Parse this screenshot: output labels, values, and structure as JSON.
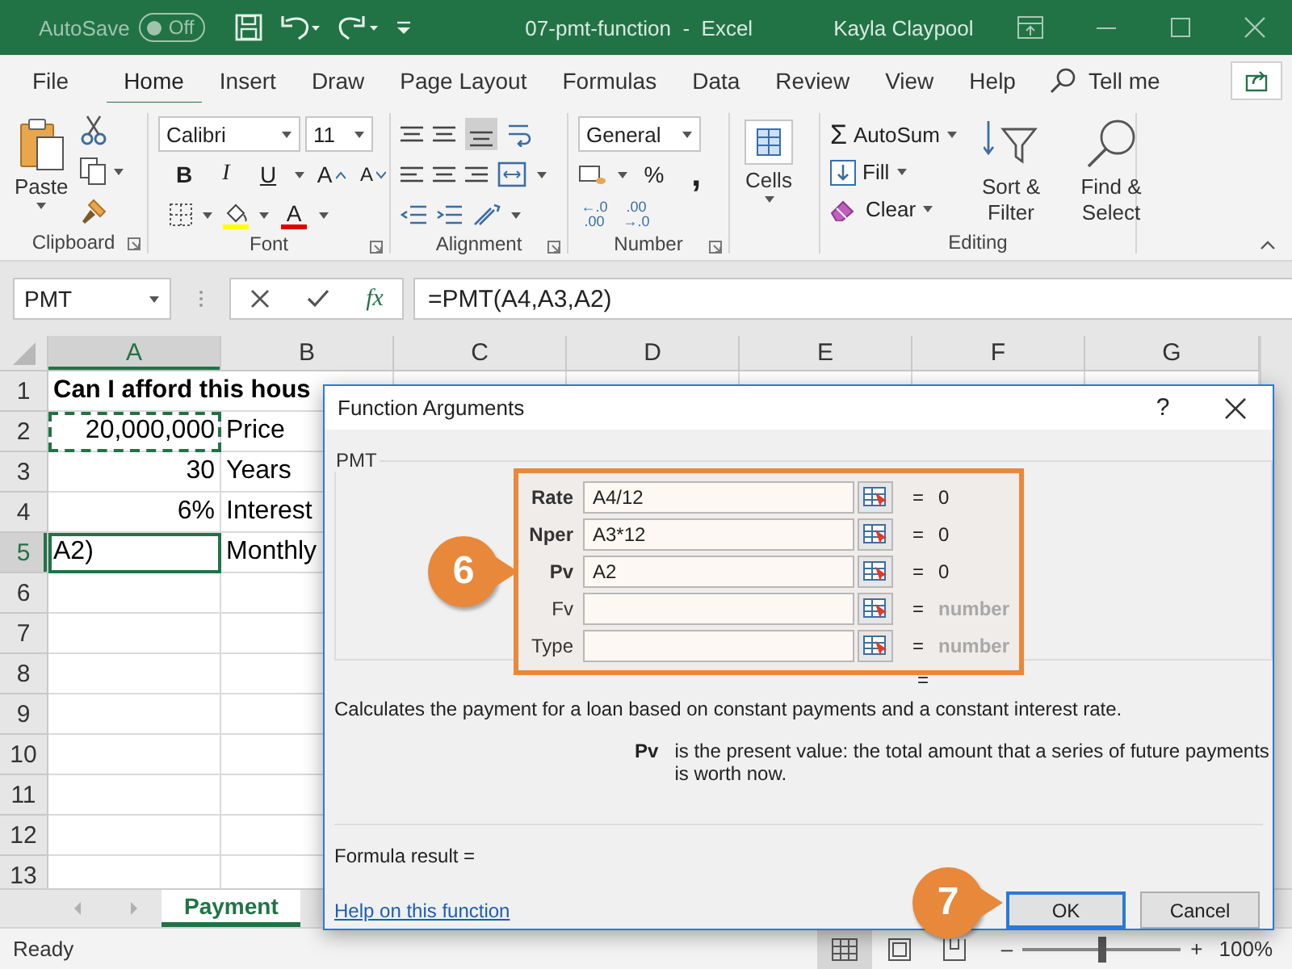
{
  "title_bar": {
    "autosave_label": "AutoSave",
    "autosave": {
      "on": false,
      "label": "Off"
    },
    "title": "07-pmt-function  -  Excel",
    "user": "Kayla Claypool"
  },
  "ribbon_tabs": [
    {
      "label": "File",
      "selected": false
    },
    {
      "label": "Home",
      "selected": true
    },
    {
      "label": "Insert",
      "selected": false
    },
    {
      "label": "Draw",
      "selected": false
    },
    {
      "label": "Page Layout",
      "selected": false
    },
    {
      "label": "Formulas",
      "selected": false
    },
    {
      "label": "Data",
      "selected": false
    },
    {
      "label": "Review",
      "selected": false
    },
    {
      "label": "View",
      "selected": false
    },
    {
      "label": "Help",
      "selected": false
    }
  ],
  "tell_me": "Tell me",
  "ribbon": {
    "clipboard": {
      "label": "Clipboard",
      "paste": "Paste"
    },
    "font": {
      "label": "Font",
      "font_name": "Calibri",
      "font_size": "11",
      "bold": "B",
      "italic": "I",
      "underline": "U",
      "grow": "A",
      "shrink": "A",
      "font_color": "A"
    },
    "alignment": {
      "label": "Alignment"
    },
    "number": {
      "label": "Number",
      "format": "General",
      "percent": "%",
      "comma": ",",
      "increase_decimal": [
        "←.0",
        ".00"
      ],
      "decrease_decimal": [
        ".00",
        "→.0"
      ]
    },
    "cells": {
      "label": "Cells"
    },
    "editing": {
      "label": "Editing",
      "autosum_sign": "Σ",
      "autosum": "AutoSum",
      "fill": "Fill",
      "clear": "Clear",
      "sort": "Sort & Filter",
      "find": "Find & Select"
    }
  },
  "formula_bar": {
    "name_box": "PMT",
    "fx": "fx",
    "formula": "=PMT(A4,A3,A2)"
  },
  "sheet": {
    "columns": [
      {
        "label": "A",
        "selected": true
      },
      {
        "label": "B",
        "selected": false
      },
      {
        "label": "C",
        "selected": false
      },
      {
        "label": "D",
        "selected": false
      },
      {
        "label": "E",
        "selected": false
      },
      {
        "label": "F",
        "selected": false
      },
      {
        "label": "G",
        "selected": false
      }
    ],
    "rows": [
      {
        "label": "1",
        "selected": false,
        "cells": {
          "A": {
            "text": "Can I afford this hous",
            "kind": "title",
            "selected": false,
            "marquee": false
          }
        }
      },
      {
        "label": "2",
        "selected": false,
        "cells": {
          "A": {
            "text": "20,000,000",
            "kind": "number",
            "selected": false,
            "marquee": true
          },
          "B": {
            "text": "Price",
            "kind": "text",
            "selected": false,
            "marquee": false
          }
        }
      },
      {
        "label": "3",
        "selected": false,
        "cells": {
          "A": {
            "text": "30",
            "kind": "number",
            "selected": false,
            "marquee": false
          },
          "B": {
            "text": "Years",
            "kind": "text",
            "selected": false,
            "marquee": false
          }
        }
      },
      {
        "label": "4",
        "selected": false,
        "cells": {
          "A": {
            "text": "6%",
            "kind": "number",
            "selected": false,
            "marquee": false
          },
          "B": {
            "text": "Interest",
            "kind": "text",
            "selected": false,
            "marquee": false
          }
        }
      },
      {
        "label": "5",
        "selected": true,
        "cells": {
          "A": {
            "text": "A2)",
            "kind": "text",
            "selected": true,
            "marquee": false
          },
          "B": {
            "text": "Monthly",
            "kind": "text",
            "selected": false,
            "marquee": false
          }
        }
      },
      {
        "label": "6",
        "selected": false
      },
      {
        "label": "7",
        "selected": false
      },
      {
        "label": "8",
        "selected": false
      },
      {
        "label": "9",
        "selected": false
      },
      {
        "label": "10",
        "selected": false
      },
      {
        "label": "11",
        "selected": false
      },
      {
        "label": "12",
        "selected": false
      },
      {
        "label": "13",
        "selected": false
      }
    ]
  },
  "sheet_tabs": [
    {
      "label": "Payment",
      "selected": true
    }
  ],
  "status_bar": {
    "status": "Ready",
    "views": [
      {
        "kind": "normal",
        "selected": true
      },
      {
        "kind": "page_layout",
        "selected": false
      },
      {
        "kind": "page_break",
        "selected": false
      }
    ],
    "zoom_out": "–",
    "zoom": {
      "level": 0.5
    },
    "zoom_in": "+",
    "zoom_label": "100%"
  },
  "dialog": {
    "title": "Function Arguments",
    "help": "?",
    "function": "PMT",
    "highlight": true,
    "arguments": [
      {
        "label": "Rate",
        "required": true,
        "value": "A4/12",
        "result": "0",
        "result_hint": false
      },
      {
        "label": "Nper",
        "required": true,
        "value": "A3*12",
        "result": "0",
        "result_hint": false
      },
      {
        "label": "Pv",
        "required": true,
        "value": "A2",
        "result": "0",
        "result_hint": false
      },
      {
        "label": "Fv",
        "required": false,
        "result": "number",
        "result_hint": true
      },
      {
        "label": "Type",
        "required": false,
        "result": "number",
        "result_hint": true
      }
    ],
    "total_equals": "=",
    "description": "Calculates the payment for a loan based on constant payments and a constant interest rate.",
    "arg_help": {
      "name": "Pv",
      "text": "is the present value: the total amount that a series of future payments is worth now."
    },
    "formula_result": "Formula result =",
    "help_link": "Help on this function",
    "buttons": [
      {
        "label": "OK",
        "default": true
      },
      {
        "label": "Cancel",
        "default": false
      }
    ]
  },
  "callouts": [
    {
      "number": "6"
    },
    {
      "number": "7"
    }
  ]
}
